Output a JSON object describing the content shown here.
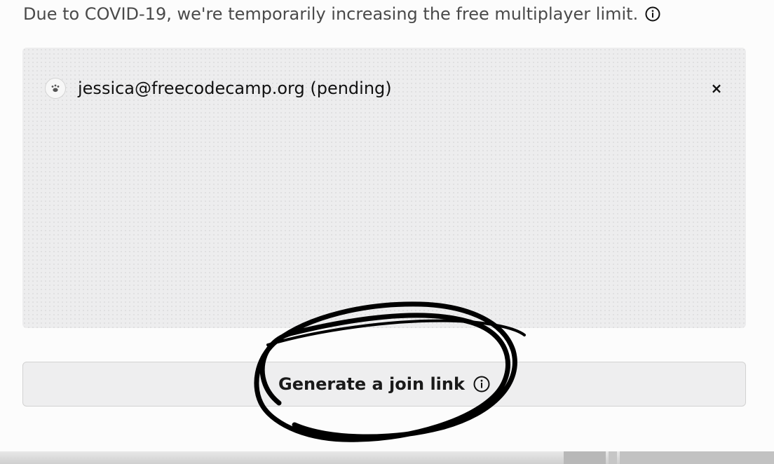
{
  "notice": {
    "text": "Due to COVID-19, we're temporarily increasing the free multiplayer limit.",
    "icon": "info-icon"
  },
  "members": [
    {
      "email": "jessica@freecodecamp.org (pending)",
      "avatar_icon": "paw-icon",
      "remove_label": "×"
    }
  ],
  "join_button": {
    "label": "Generate a join link",
    "icon": "info-icon"
  },
  "colors": {
    "panel": "#ededee",
    "button": "#eeeeef",
    "annotation_ink": "#000000"
  }
}
